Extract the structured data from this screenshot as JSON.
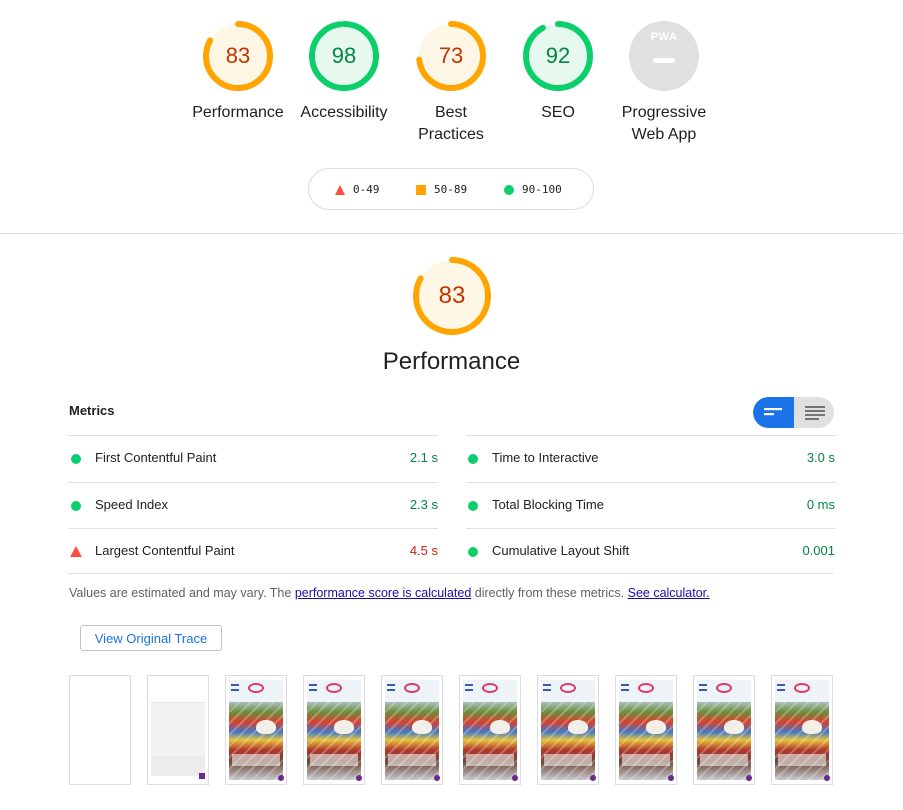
{
  "categories": [
    {
      "score": "83",
      "label": "Performance",
      "status": "average",
      "color": "#ffa400",
      "fill": 0.83
    },
    {
      "score": "98",
      "label": "Accessibility",
      "status": "pass",
      "color": "#0cce6b",
      "fill": 0.98
    },
    {
      "score": "73",
      "label": "Best Practices",
      "status": "average",
      "color": "#ffa400",
      "fill": 0.73
    },
    {
      "score": "92",
      "label": "SEO",
      "status": "pass",
      "color": "#0cce6b",
      "fill": 0.92
    },
    {
      "score": "",
      "label": "Progressive Web App",
      "status": "na",
      "badge_text": "PWA"
    }
  ],
  "legend": [
    {
      "range": "0-49",
      "shape": "triangle",
      "color": "#ff4e42"
    },
    {
      "range": "50-89",
      "shape": "square",
      "color": "#ffa400"
    },
    {
      "range": "90-100",
      "shape": "circle",
      "color": "#0cce6b"
    }
  ],
  "performance": {
    "score": "83",
    "fill": 0.83,
    "title": "Performance",
    "metrics_header": "Metrics",
    "metrics": [
      {
        "name": "First Contentful Paint",
        "value": "2.1 s",
        "rating": "pass"
      },
      {
        "name": "Time to Interactive",
        "value": "3.0 s",
        "rating": "pass"
      },
      {
        "name": "Speed Index",
        "value": "2.3 s",
        "rating": "pass"
      },
      {
        "name": "Total Blocking Time",
        "value": "0 ms",
        "rating": "pass"
      },
      {
        "name": "Largest Contentful Paint",
        "value": "4.5 s",
        "rating": "fail"
      },
      {
        "name": "Cumulative Layout Shift",
        "value": "0.001",
        "rating": "pass"
      }
    ],
    "note_prefix": "Values are estimated and may vary. The ",
    "note_link": "performance score is calculated",
    "note_middle": " directly from these metrics.",
    "note_calc_link": "See calculator.",
    "trace_button": "View Original Trace"
  },
  "colors": {
    "pass": "#0cce6b",
    "average": "#ffa400",
    "fail": "#ff4e42",
    "accent": "#1a73e8"
  },
  "icons": {
    "view_toggle_active": "lines-compact-icon",
    "view_toggle_inactive": "lines-expanded-icon"
  }
}
